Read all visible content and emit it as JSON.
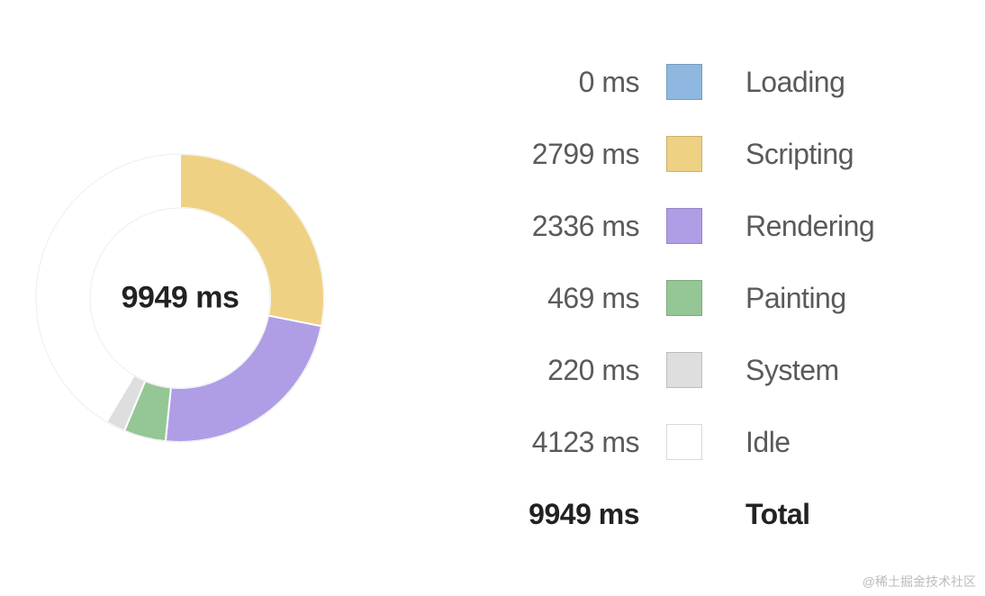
{
  "center_label": "9949 ms",
  "unit": "ms",
  "total_label": "Total",
  "total_value": 9949,
  "series": [
    {
      "label": "Loading",
      "value": 0,
      "color": "#8fb8e0",
      "value_text": "0 ms"
    },
    {
      "label": "Scripting",
      "value": 2799,
      "color": "#eed183",
      "value_text": "2799 ms"
    },
    {
      "label": "Rendering",
      "value": 2336,
      "color": "#af9ee6",
      "value_text": "2336 ms"
    },
    {
      "label": "Painting",
      "value": 469,
      "color": "#94c795",
      "value_text": "469 ms"
    },
    {
      "label": "System",
      "value": 220,
      "color": "#dedede",
      "value_text": "220 ms"
    },
    {
      "label": "Idle",
      "value": 4123,
      "color": "#ffffff",
      "value_text": "4123 ms"
    }
  ],
  "chart_data": {
    "type": "pie",
    "title": "",
    "categories": [
      "Loading",
      "Scripting",
      "Rendering",
      "Painting",
      "System",
      "Idle"
    ],
    "values": [
      0,
      2799,
      2336,
      469,
      220,
      4123
    ],
    "total": 9949,
    "unit": "ms",
    "inner_radius_ratio": 0.62
  },
  "watermark": "@稀土掘金技术社区"
}
